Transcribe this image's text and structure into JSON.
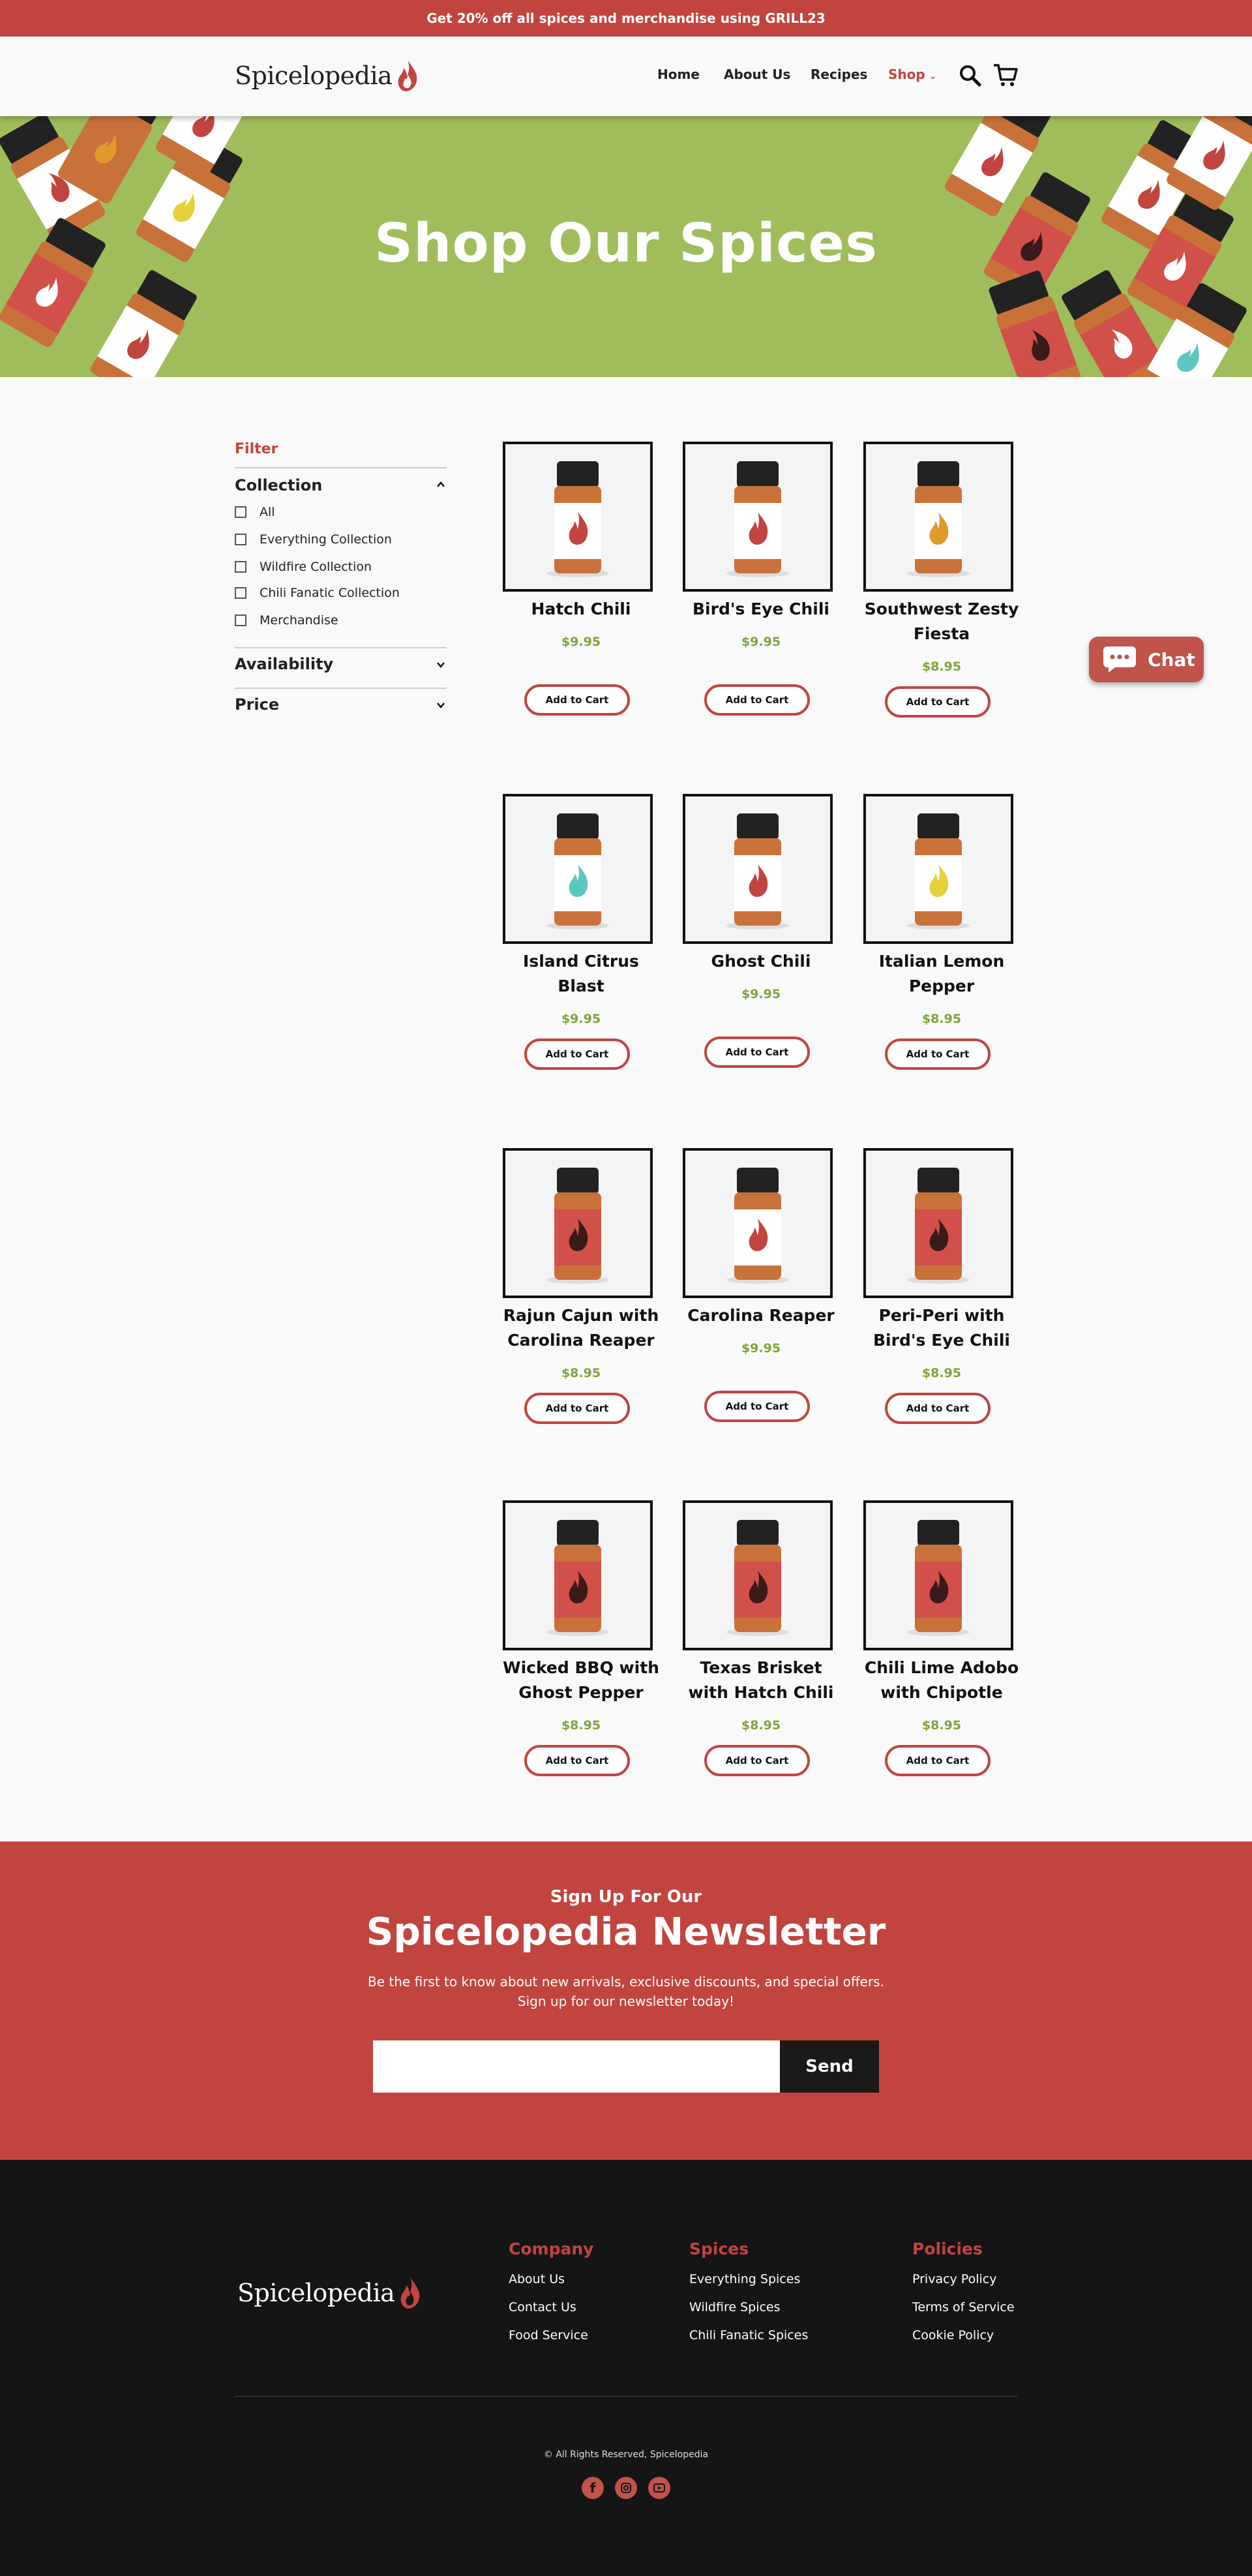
{
  "promo": {
    "text": "Get 20% off all spices and merchandise using GRILL23"
  },
  "brand": {
    "name": "Spicelopedia",
    "accent": "#c1443f",
    "price_green": "#7ea53a",
    "hero_green": "#a0bd5c",
    "footer_bg": "#151515"
  },
  "nav": {
    "items": [
      "Home",
      "About Us",
      "Recipes",
      "Shop"
    ],
    "active": "Shop",
    "icons": [
      "search-icon",
      "cart-icon"
    ]
  },
  "hero": {
    "title": "Shop Our Spices"
  },
  "filter": {
    "title": "Filter",
    "collection": {
      "title": "Collection",
      "options": [
        "All",
        "Everything Collection",
        "Wildfire Collection",
        "Chili Fanatic Collection",
        "Merchandise"
      ]
    },
    "availability": {
      "title": "Availability"
    },
    "price": {
      "title": "Price"
    }
  },
  "products": [
    {
      "name": "Hatch Chili",
      "price": "$9.95",
      "label_color": "#ffffff",
      "flame": "#c1443f",
      "button": "Add to Cart"
    },
    {
      "name": "Bird's Eye Chili",
      "price": "$9.95",
      "label_color": "#ffffff",
      "flame": "#c1443f",
      "button": "Add to Cart"
    },
    {
      "name": "Southwest Zesty Fiesta",
      "price": "$8.95",
      "label_color": "#ffffff",
      "flame": "#e09a2a",
      "button": "Add to Cart"
    },
    {
      "name": "Island Citrus Blast",
      "price": "$9.95",
      "label_color": "#ffffff",
      "flame": "#5cc6c0",
      "button": "Add to Cart"
    },
    {
      "name": "Ghost Chili",
      "price": "$9.95",
      "label_color": "#ffffff",
      "flame": "#c1443f",
      "button": "Add to Cart"
    },
    {
      "name": "Italian Lemon Pepper",
      "price": "$8.95",
      "label_color": "#ffffff",
      "flame": "#e5d23a",
      "button": "Add to Cart"
    },
    {
      "name": "Rajun Cajun with Carolina Reaper",
      "price": "$8.95",
      "label_color": "#d2504a",
      "flame": "#3a1a1a",
      "button": "Add to Cart"
    },
    {
      "name": "Carolina Reaper",
      "price": "$9.95",
      "label_color": "#ffffff",
      "flame": "#c1443f",
      "button": "Add to Cart"
    },
    {
      "name": "Peri-Peri with Bird's Eye Chili",
      "price": "$8.95",
      "label_color": "#d2504a",
      "flame": "#3a1a1a",
      "button": "Add to Cart"
    },
    {
      "name": "Wicked BBQ with Ghost Pepper",
      "price": "$8.95",
      "label_color": "#d2504a",
      "flame": "#3a1a1a",
      "button": "Add to Cart"
    },
    {
      "name": "Texas Brisket with Hatch Chili",
      "price": "$8.95",
      "label_color": "#d2504a",
      "flame": "#3a1a1a",
      "button": "Add to Cart"
    },
    {
      "name": "Chili Lime Adobo with Chipotle",
      "price": "$8.95",
      "label_color": "#d2504a",
      "flame": "#3a1a1a",
      "button": "Add to Cart"
    }
  ],
  "chat": {
    "label": "Chat"
  },
  "newsletter": {
    "kicker": "Sign Up For Our",
    "title": "Spicelopedia Newsletter",
    "body": "Be the first to know about new arrivals, exclusive discounts, and special offers. Sign up for our newsletter today!",
    "input_placeholder": "",
    "button": "Send"
  },
  "footer": {
    "columns": [
      {
        "title": "Company",
        "links": [
          "About Us",
          "Contact Us",
          "Food Service"
        ]
      },
      {
        "title": "Spices",
        "links": [
          "Everything Spices",
          "Wildfire Spices",
          "Chili Fanatic Spices"
        ]
      },
      {
        "title": "Policies",
        "links": [
          "Privacy Policy",
          "Terms of Service",
          "Cookie Policy"
        ]
      }
    ],
    "copyright": "© All Rights Reserved, Spicelopedia",
    "social": [
      "facebook-icon",
      "instagram-icon",
      "youtube-icon"
    ]
  }
}
